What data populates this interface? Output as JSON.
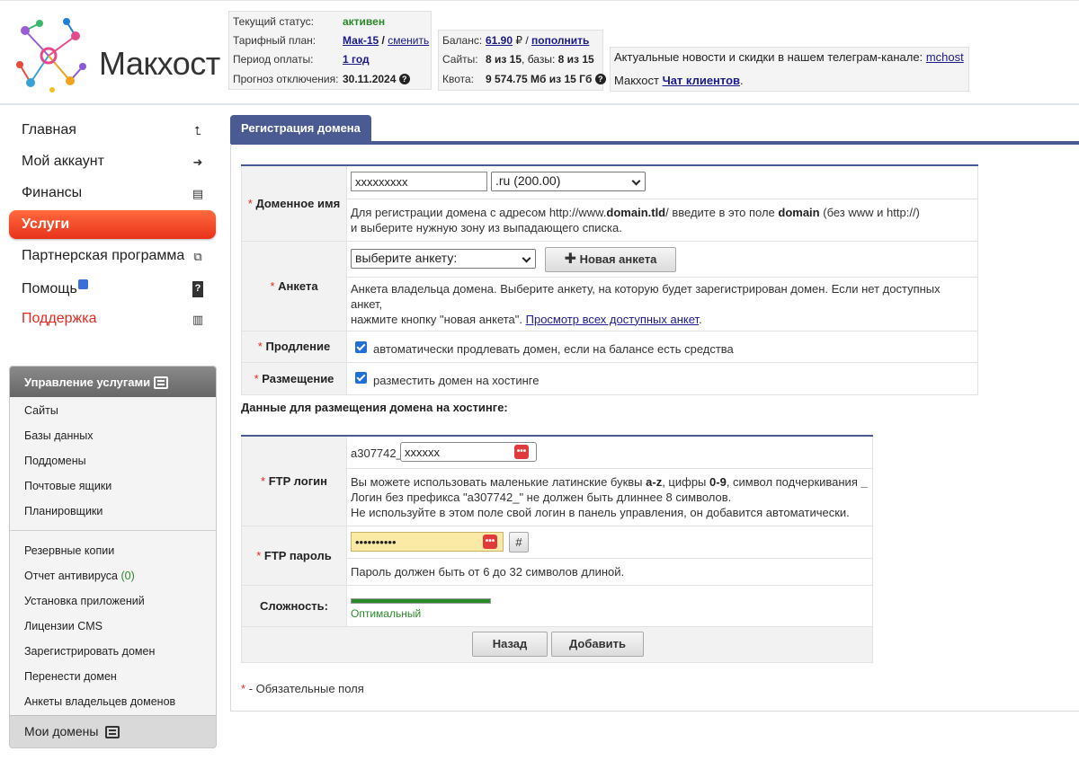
{
  "header": {
    "logo_text": "Макхост",
    "status": {
      "status_label": "Текущий статус:",
      "status_value": "активен",
      "plan_label": "Тарифный план:",
      "plan_value": "Мак-15",
      "plan_change": "сменить",
      "period_label": "Период оплаты:",
      "period_value": "1 год",
      "forecast_label": "Прогноз отключения:",
      "forecast_value": "30.11.2024"
    },
    "balance": {
      "balance_label": "Баланс:",
      "balance_value": "61.90",
      "currency": "₽",
      "topup": "пополнить",
      "sites_label": "Сайты:",
      "sites_value": "8 из 15",
      "db_label": "базы:",
      "db_value": "8 из 15",
      "quota_label": "Квота:",
      "quota_value": "9 574.75 Мб из 15 Гб"
    },
    "news": {
      "line1": "Актуальные новости и скидки в нашем телеграм-канале:",
      "channel": "mchost",
      "brand": "Макхост",
      "chat_link": "Чат клиентов"
    }
  },
  "menu": [
    {
      "label": "Главная",
      "icon": "home-arrow-icon"
    },
    {
      "label": "Мой аккаунт",
      "icon": "user-icon"
    },
    {
      "label": "Финансы",
      "icon": "money-icon"
    },
    {
      "label": "Услуги",
      "icon": "services-icon",
      "active": true
    },
    {
      "label": "Партнерская программа",
      "icon": "partner-icon"
    },
    {
      "label": "Помощь",
      "icon": "help-icon"
    },
    {
      "label": "Поддержка",
      "icon": "support-icon"
    }
  ],
  "services_panel": {
    "title": "Управление услугами",
    "items_top": [
      "Сайты",
      "Базы данных",
      "Поддомены",
      "Почтовые ящики",
      "Планировщики"
    ],
    "items_bottom": [
      "Резервные копии",
      "Отчет антивируса",
      "Установка приложений",
      "Лицензии CMS",
      "Зарегистрировать домен",
      "Перенести домен",
      "Анкеты владельцев доменов"
    ],
    "antivirus_count": "(0)",
    "footer": "Мои домены"
  },
  "tab": {
    "label": "Регистрация домена"
  },
  "form": {
    "required_mark": "*",
    "domain": {
      "label": "Доменное имя",
      "value": "xxxxxxxxx",
      "zone": ".ru (200.00)",
      "desc_1": "Для регистрации домена с адресом http://www.",
      "desc_bold1": "domain.tld",
      "desc_2": "/ введите в это поле ",
      "desc_bold2": "domain",
      "desc_3": " (без www и http://)",
      "desc_line2": "и выберите нужную зону из выпадающего списка."
    },
    "anketa": {
      "label": "Анкета",
      "select": "выберите анкету:",
      "new_button": "Новая анкета",
      "desc_line1": "Анкета владельца домена. Выберите анкету, на которую будет зарегистрирован домен. Если нет доступных анкет,",
      "desc_line2": "нажмите кнопку \"новая анкета\". ",
      "desc_link": "Просмотр всех доступных анкет",
      "desc_end": "."
    },
    "renewal": {
      "label": "Продление",
      "text": "автоматически продлевать домен, если на балансе есть средства"
    },
    "hosting": {
      "label": "Размещение",
      "text": "разместить домен на хостинге"
    }
  },
  "hosting_section": {
    "title": "Данные для размещения домена на хостинге:",
    "ftp_login": {
      "label": "FTP логин",
      "prefix": "a307742_",
      "value": "xxxxxx",
      "desc_1": "Вы можете использовать маленькие латинские буквы ",
      "desc_b1": "a-z",
      "desc_2": ", цифры ",
      "desc_b2": "0-9",
      "desc_3": ", символ подчеркивания ",
      "desc_b3": "_",
      "desc_line2": "Логин без префикса \"a307742_\" не должен быть длиннее 8 символов.",
      "desc_line3": "Не используйте в этом поле свой логин в панель управления, он добавится автоматически."
    },
    "ftp_password": {
      "label": "FTP пароль",
      "value": "••••••••••",
      "gen_button": "#",
      "desc": "Пароль должен быть от 6 до 32 символов длиной."
    },
    "complexity": {
      "label": "Сложность:",
      "value": "Оптимальный",
      "level": 1.0
    },
    "buttons": {
      "back": "Назад",
      "add": "Добавить"
    }
  },
  "required_note": "- Обязательные поля",
  "colors": {
    "accent": "#4a5a92",
    "active_menu": "#e8321b",
    "required": "#e0281e",
    "strength": "#2a8a2a"
  }
}
